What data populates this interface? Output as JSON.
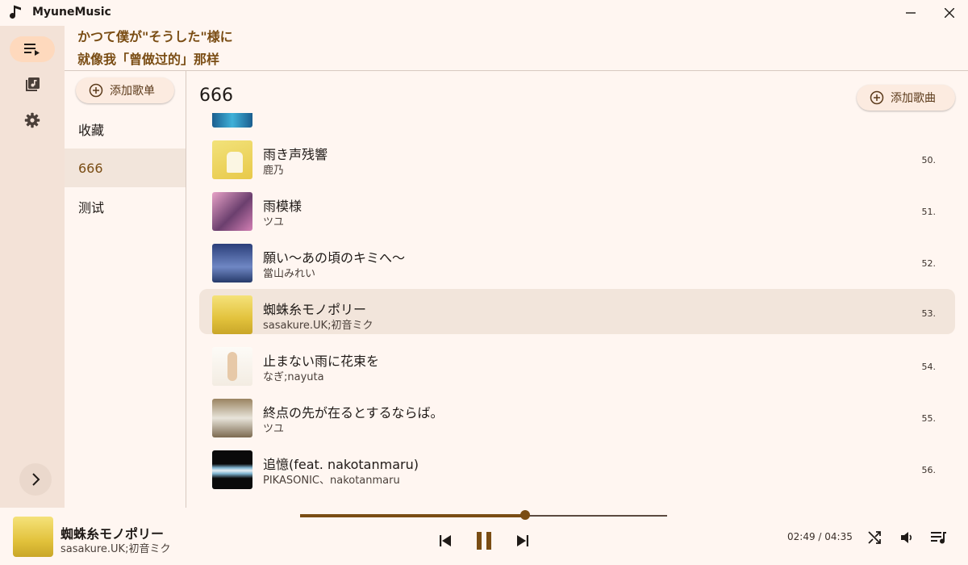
{
  "app": {
    "title": "MyuneMusic"
  },
  "lyrics": {
    "line1": "かつて僕が\"そうした\"様に",
    "line2": "就像我「曾做过的」那样"
  },
  "sidebar": {
    "add_playlist_label": "添加歌单",
    "playlists": [
      {
        "label": "收藏"
      },
      {
        "label": "666"
      },
      {
        "label": "测试"
      }
    ]
  },
  "main": {
    "playlist_title": "666",
    "add_song_label": "添加歌曲",
    "songs": [
      {
        "title": "雨き声残響",
        "artist": "鹿乃",
        "index": "50."
      },
      {
        "title": "雨模様",
        "artist": "ツユ",
        "index": "51."
      },
      {
        "title": "願い～あの頃のキミへ～",
        "artist": "當山みれい",
        "index": "52."
      },
      {
        "title": "蜘蛛糸モノポリー",
        "artist": "sasakure.UK;初音ミク",
        "index": "53."
      },
      {
        "title": "止まない雨に花束を",
        "artist": "なぎ;nayuta",
        "index": "54."
      },
      {
        "title": "終点の先が在るとするならば。",
        "artist": "ツユ",
        "index": "55."
      },
      {
        "title": "追憶(feat. nakotanmaru)",
        "artist": "PIKASONIC、nakotanmaru",
        "index": "56."
      }
    ]
  },
  "player": {
    "title": "蜘蛛糸モノポリー",
    "artist": "sasakure.UK;初音ミク",
    "time": "02:49 / 04:35",
    "progress": 0.614
  },
  "colors": {
    "accent": "#7a4d14",
    "nav_active": "#fed9bd",
    "row_active": "#f2e5db",
    "rail": "#f3e2d7"
  },
  "icons": {
    "app": "music-note-icon",
    "nav": [
      "queue-music-icon",
      "library-music-icon",
      "settings-icon"
    ],
    "player": [
      "skip-previous-icon",
      "pause-icon",
      "skip-next-icon",
      "shuffle-icon",
      "volume-icon",
      "queue-icon"
    ]
  }
}
